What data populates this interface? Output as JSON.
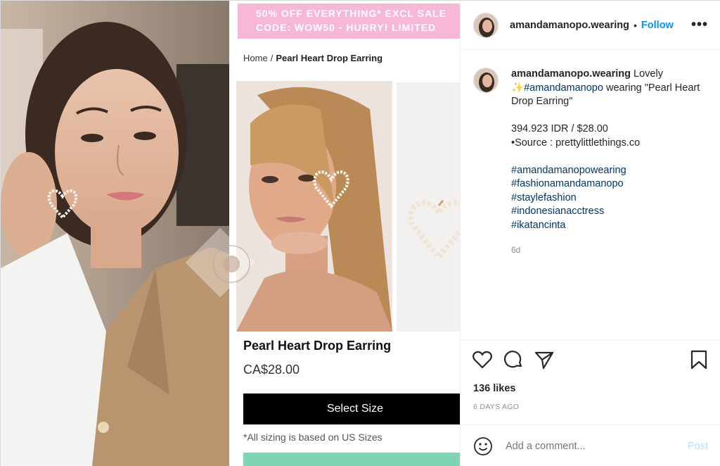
{
  "promo": {
    "line1": "50% OFF EVERYTHING* EXCL SALE",
    "line2": "CODE: WOW50 - HURRY! LIMITED"
  },
  "breadcrumb": {
    "home": "Home",
    "separator": "/",
    "current": "Pearl Heart Drop Earring"
  },
  "product": {
    "title": "Pearl Heart Drop Earring",
    "price": "CA$28.00",
    "select_size_label": "Select Size",
    "sizing_note": "*All sizing is based on US Sizes"
  },
  "header": {
    "username": "amandamanopo.wearing",
    "separator": "•",
    "follow_label": "Follow",
    "more_label": "•••"
  },
  "caption": {
    "username": "amandamanopo.wearing",
    "text_intro": "Lovely",
    "mention": "#amandamanopo",
    "text_after": "wearing \"Pearl Heart Drop Earring\"",
    "price_line": "394.923 IDR / $28.00",
    "source_line": "•Source : prettylittlethings.co",
    "hashtags": [
      "#amandamanopowearing",
      "#fashionamandamanopo",
      "#staylefashion",
      "#indonesianacctress",
      "#ikatancinta"
    ],
    "time_ago": "6d"
  },
  "stats": {
    "likes": "136 likes",
    "date": "6 DAYS AGO"
  },
  "comment": {
    "placeholder": "Add a comment...",
    "post_label": "Post"
  },
  "colors": {
    "follow": "#0095f6",
    "hashtag": "#00376b",
    "promo_bg": "#f7b7d6",
    "post_disabled": "#b2dffc"
  },
  "icons": [
    "heart-icon",
    "comment-icon",
    "share-icon",
    "bookmark-icon",
    "emoji-icon",
    "more-icon"
  ]
}
